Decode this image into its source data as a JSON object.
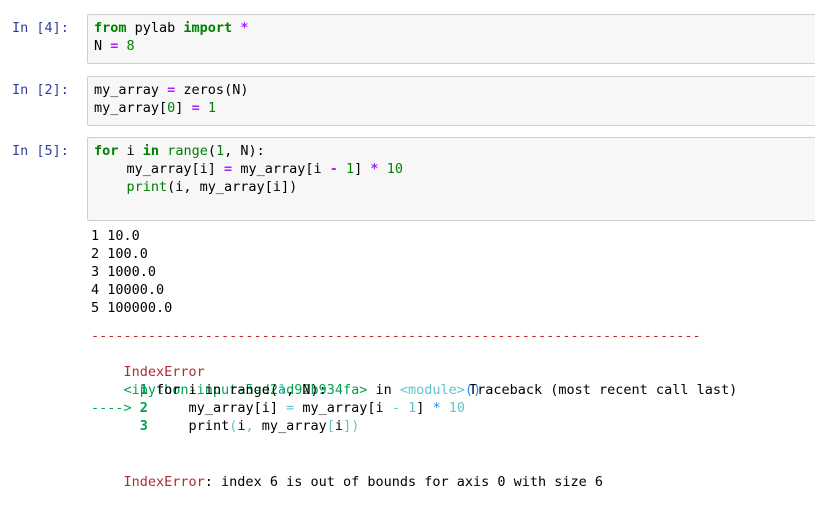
{
  "cells": [
    {
      "prompt": "In [4]:",
      "lines": [
        [
          {
            "t": "from",
            "c": "kw"
          },
          {
            "t": " pylab ",
            "c": ""
          },
          {
            "t": "import",
            "c": "kw"
          },
          {
            "t": " ",
            "c": ""
          },
          {
            "t": "*",
            "c": "op"
          }
        ],
        [
          {
            "t": "N ",
            "c": ""
          },
          {
            "t": "=",
            "c": "op"
          },
          {
            "t": " ",
            "c": ""
          },
          {
            "t": "8",
            "c": "num"
          }
        ]
      ]
    },
    {
      "prompt": "In [2]:",
      "lines": [
        [
          {
            "t": "my_array ",
            "c": ""
          },
          {
            "t": "=",
            "c": "op"
          },
          {
            "t": " zeros(N)",
            "c": ""
          }
        ],
        [
          {
            "t": "my_array[",
            "c": ""
          },
          {
            "t": "0",
            "c": "num"
          },
          {
            "t": "] ",
            "c": ""
          },
          {
            "t": "=",
            "c": "op"
          },
          {
            "t": " ",
            "c": ""
          },
          {
            "t": "1",
            "c": "num"
          }
        ]
      ]
    },
    {
      "prompt": "In [5]:",
      "lines": [
        [
          {
            "t": "for",
            "c": "kw"
          },
          {
            "t": " i ",
            "c": ""
          },
          {
            "t": "in",
            "c": "kw"
          },
          {
            "t": " ",
            "c": ""
          },
          {
            "t": "range",
            "c": "bi"
          },
          {
            "t": "(",
            "c": ""
          },
          {
            "t": "1",
            "c": "num"
          },
          {
            "t": ", N):",
            "c": ""
          }
        ],
        [
          {
            "t": "    my_array[i] ",
            "c": ""
          },
          {
            "t": "=",
            "c": "op"
          },
          {
            "t": " my_array[i ",
            "c": ""
          },
          {
            "t": "-",
            "c": "op"
          },
          {
            "t": " ",
            "c": ""
          },
          {
            "t": "1",
            "c": "num"
          },
          {
            "t": "] ",
            "c": ""
          },
          {
            "t": "*",
            "c": "op"
          },
          {
            "t": " ",
            "c": ""
          },
          {
            "t": "10",
            "c": "num"
          }
        ],
        [
          {
            "t": "    ",
            "c": ""
          },
          {
            "t": "print",
            "c": "bi"
          },
          {
            "t": "(i, my_array[i])",
            "c": ""
          }
        ]
      ]
    }
  ],
  "output": {
    "stdout": [
      "1 10.0",
      "2 100.0",
      "3 1000.0",
      "4 10000.0",
      "5 100000.0"
    ],
    "traceback": {
      "separator": "---------------------------------------------------------------------------",
      "error_name": "IndexError",
      "header_right": "Traceback (most recent call last)",
      "location_file": "<ipython-input-5-d2ad92b934fa>",
      "location_in": " in ",
      "location_module": "<module>",
      "location_parens": "()",
      "frame_lines": [
        {
          "prefix": "      ",
          "num": "1",
          "code": [
            {
              "t": " for i in range(",
              "c": ""
            },
            {
              "t": "1",
              "c": "err-cyan"
            },
            {
              "t": ", N):",
              "c": ""
            }
          ]
        },
        {
          "prefix": "----> ",
          "num": "2",
          "code": [
            {
              "t": "     my_array[i] ",
              "c": ""
            },
            {
              "t": "=",
              "c": "err-cyan"
            },
            {
              "t": " my_array[i ",
              "c": ""
            },
            {
              "t": "-",
              "c": "err-cyan"
            },
            {
              "t": " ",
              "c": ""
            },
            {
              "t": "1",
              "c": "err-cyan"
            },
            {
              "t": "] ",
              "c": ""
            },
            {
              "t": "*",
              "c": "err-blue"
            },
            {
              "t": " ",
              "c": ""
            },
            {
              "t": "10",
              "c": "err-cyan"
            }
          ]
        },
        {
          "prefix": "      ",
          "num": "3",
          "code": [
            {
              "t": "     print",
              "c": ""
            },
            {
              "t": "(",
              "c": "err-cyan"
            },
            {
              "t": "i",
              "c": ""
            },
            {
              "t": ",",
              "c": "err-cyan"
            },
            {
              "t": " my_array",
              "c": ""
            },
            {
              "t": "[",
              "c": "err-cyan"
            },
            {
              "t": "i",
              "c": ""
            },
            {
              "t": "]",
              "c": "err-cyan"
            },
            {
              "t": ")",
              "c": "err-cyan"
            }
          ]
        }
      ],
      "final_error_name": "IndexError",
      "final_message": ": index 6 is out of bounds for axis 0 with size 6"
    }
  },
  "colors": {
    "prompt": "#303f9f",
    "keyword": "#008000",
    "operator": "#aa22ff",
    "error_red": "#b22b31",
    "error_green": "#00a250",
    "error_cyan": "#60c6c8"
  }
}
